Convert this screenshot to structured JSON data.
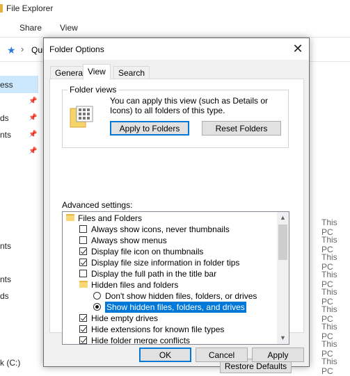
{
  "explorer": {
    "title": "File Explorer",
    "ribbon_tabs": [
      "Share",
      "View"
    ],
    "address_text": "Qui",
    "nav_items": [
      "ess",
      "ds",
      "nts",
      "nts",
      "nts",
      "ds",
      "k (C:)"
    ],
    "location_items": [
      "This PC",
      "This PC",
      "This PC",
      "This PC",
      "This PC",
      "This PC",
      "This PC",
      "This PC",
      "This PC",
      "This PC"
    ]
  },
  "dialog": {
    "title": "Folder Options",
    "tabs": [
      "General",
      "View",
      "Search"
    ],
    "folder_views": {
      "heading": "Folder views",
      "description": "You can apply this view (such as Details or Icons) to all folders of this type.",
      "apply_button": "Apply to Folders",
      "reset_button": "Reset Folders"
    },
    "advanced_label": "Advanced settings:",
    "tree": [
      {
        "type": "folder",
        "label": "Files and Folders",
        "indent": 0
      },
      {
        "type": "checkbox",
        "label": "Always show icons, never thumbnails",
        "checked": false,
        "indent": 1
      },
      {
        "type": "checkbox",
        "label": "Always show menus",
        "checked": false,
        "indent": 1
      },
      {
        "type": "checkbox",
        "label": "Display file icon on thumbnails",
        "checked": true,
        "indent": 1
      },
      {
        "type": "checkbox",
        "label": "Display file size information in folder tips",
        "checked": true,
        "indent": 1
      },
      {
        "type": "checkbox",
        "label": "Display the full path in the title bar",
        "checked": false,
        "indent": 1
      },
      {
        "type": "folder",
        "label": "Hidden files and folders",
        "indent": 1
      },
      {
        "type": "radio",
        "label": "Don't show hidden files, folders, or drives",
        "checked": false,
        "indent": 2
      },
      {
        "type": "radio",
        "label": "Show hidden files, folders, and drives",
        "checked": true,
        "selected": true,
        "indent": 2
      },
      {
        "type": "checkbox",
        "label": "Hide empty drives",
        "checked": true,
        "indent": 1
      },
      {
        "type": "checkbox",
        "label": "Hide extensions for known file types",
        "checked": true,
        "indent": 1
      },
      {
        "type": "checkbox",
        "label": "Hide folder merge conflicts",
        "checked": true,
        "indent": 1
      }
    ],
    "restore_button": "Restore Defaults",
    "ok_button": "OK",
    "cancel_button": "Cancel",
    "apply_button": "Apply",
    "close_glyph": "✕"
  },
  "colors": {
    "selection": "#0078d7",
    "nav_selected": "#cce8ff",
    "accent_pin": "#2a7bd7"
  }
}
